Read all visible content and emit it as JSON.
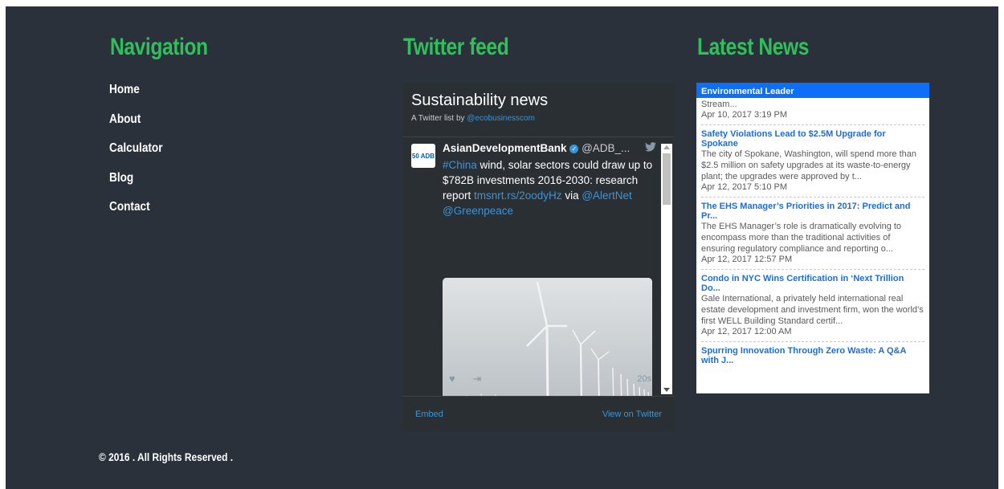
{
  "columns": {
    "navigation_title": "Navigation",
    "twitter_title": "Twitter feed",
    "news_title": "Latest News"
  },
  "nav": {
    "items": [
      "Home",
      "About",
      "Calculator",
      "Blog",
      "Contact"
    ]
  },
  "footer": {
    "text": "© 2016 . All Rights Reserved ."
  },
  "twitter": {
    "list_title": "Sustainability news",
    "subtitle_prefix": "A Twitter list by",
    "subtitle_link": "@ecobusinesscom",
    "tweet": {
      "avatar_text": "50 ADB",
      "author_name": "AsianDevelopmentBank",
      "author_handle": "@ADB_...",
      "hashtag": "#China",
      "text_1": " wind, solar sectors could draw up to $782B investments 2016-2030: research report ",
      "link": "tmsnrt.rs/2oodyHz",
      "via": " via ",
      "mention_1": "@AlertNet",
      "mention_2": "@Greenpeace",
      "time": "20s"
    },
    "footer_embed": "Embed",
    "footer_view": "View on Twitter",
    "icons": [
      "verified-badge-icon",
      "twitter-bird-icon",
      "heart-icon",
      "share-icon"
    ]
  },
  "news": {
    "header": "Environmental Leader",
    "first_item": {
      "desc": "Stream...",
      "time": "Apr 10, 2017 3:19 PM"
    },
    "items": [
      {
        "title": "Safety Violations Lead to $2.5M Upgrade for Spokane",
        "desc": "The city of Spokane, Washington, will spend more than $2.5 million on safety upgrades at its waste-to-energy plant; the upgrades were approved by t...",
        "time": "Apr 12, 2017 5:10 PM"
      },
      {
        "title": "The EHS Manager’s Priorities in 2017: Predict and Pr...",
        "desc": "The EHS Manager’s role is dramatically evolving to encompass more than the traditional activities of ensuring regulatory compliance and reporting o...",
        "time": "Apr 12, 2017 12:57 PM"
      },
      {
        "title": "Condo in NYC Wins Certification in ‘Next Trillion Do...",
        "desc": "Gale International, a privately held international real estate development and investment firm, won the world’s first WELL Building Standard certif...",
        "time": "Apr 12, 2017 12:00 AM"
      },
      {
        "title": "Spurring Innovation Through Zero Waste: A Q&A with J...",
        "desc": "",
        "time": ""
      }
    ]
  },
  "colors": {
    "background": "#2b313b",
    "heading_green": "#2fbf5b",
    "twitter_widget_bg": "#292f33",
    "twitter_link": "#3b94d9",
    "news_header_blue": "#0d6ef7",
    "news_title_blue": "#1a6ed8"
  }
}
